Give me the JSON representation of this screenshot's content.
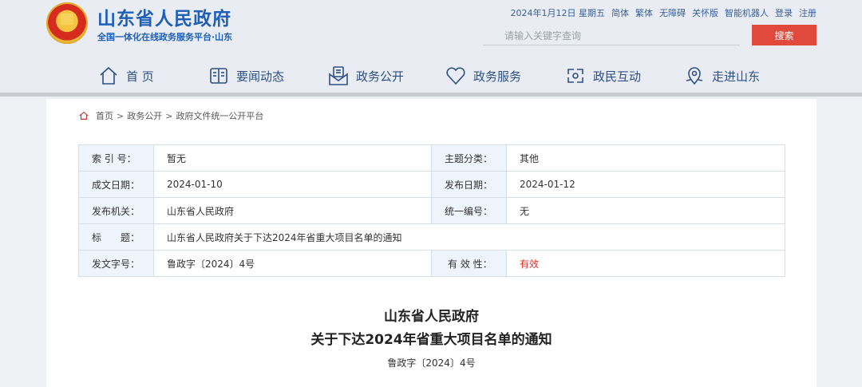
{
  "header": {
    "title": "山东省人民政府",
    "subtitle": "全国一体化在线政务服务平台·山东",
    "date": "2024年1月12日 星期五",
    "links": [
      "简体",
      "繁体",
      "无障碍",
      "关怀版",
      "智能机器人",
      "登录",
      "注册"
    ],
    "search_placeholder": "请输入关键字查询",
    "search_button": "搜索"
  },
  "nav": {
    "items": [
      {
        "label": "首 页",
        "icon": "home-icon"
      },
      {
        "label": "要闻动态",
        "icon": "news-icon"
      },
      {
        "label": "政务公开",
        "icon": "open-government-icon"
      },
      {
        "label": "政务服务",
        "icon": "heart-service-icon"
      },
      {
        "label": "政民互动",
        "icon": "interaction-icon"
      },
      {
        "label": "走进山东",
        "icon": "location-icon"
      }
    ]
  },
  "breadcrumb": {
    "icon": "home-icon",
    "items": [
      "首页",
      "政务公开",
      "政府文件统一公开平台"
    ],
    "separator": ">"
  },
  "meta": {
    "index_label": "索 引 号：",
    "index_value": "暂无",
    "category_label": "主题分类：",
    "category_value": "其他",
    "created_label": "成文日期：",
    "created_value": "2024-01-10",
    "published_label": "发布日期：",
    "published_value": "2024-01-12",
    "issuer_label": "发布机关：",
    "issuer_value": "山东省人民政府",
    "serial_label": "统一编号：",
    "serial_value": "无",
    "title_label": "标　　题：",
    "title_value": "山东省人民政府关于下达2024年省重大项目名单的通知",
    "docno_label": "发文字号：",
    "docno_value": "鲁政字〔2024〕4号",
    "validity_label": "有 效 性：",
    "validity_value": "有效"
  },
  "document": {
    "title_line1": "山东省人民政府",
    "title_line2": "关于下达2024年省重大项目名单的通知",
    "number": "鲁政字〔2024〕4号"
  },
  "colors": {
    "brand_blue": "#1e5fb8",
    "search_red": "#e0493b",
    "valid_red": "#d9342b"
  }
}
